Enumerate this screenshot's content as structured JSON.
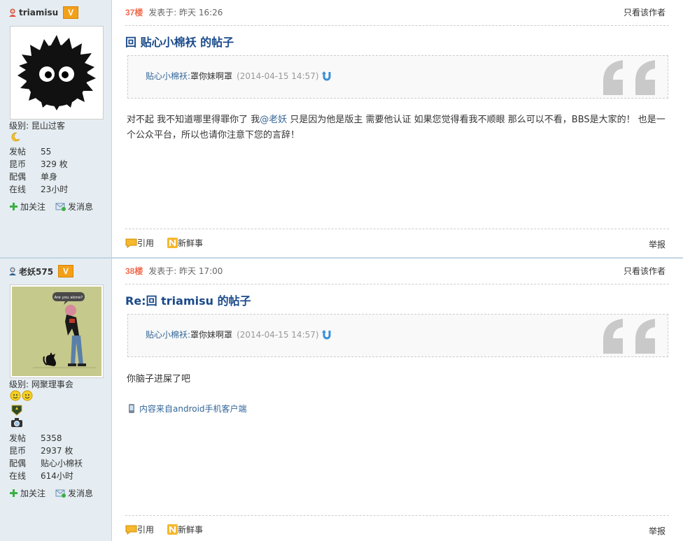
{
  "posts": [
    {
      "user": {
        "name": "triamisu",
        "badge": "V",
        "level_label": "级别:",
        "level": "昆山过客",
        "stats": [
          {
            "k": "发帖",
            "v": "55"
          },
          {
            "k": "昆币",
            "v": "329 枚"
          },
          {
            "k": "配偶",
            "v": "单身"
          },
          {
            "k": "在线",
            "v": "23小时"
          }
        ],
        "follow": "加关注",
        "message": "发消息"
      },
      "floor": "37楼",
      "posted": "发表于: 昨天 16:26",
      "only_author": "只看该作者",
      "title": "回 贴心小棉袄 的帖子",
      "quote": {
        "author": "贴心小棉袄:",
        "text": "罩你妹啊罩",
        "date": "(2014-04-15 14:57)"
      },
      "body_1": "对不起  我不知道哪里得罪你了  我",
      "mention": "@老妖",
      "body_2": "  只是因为他是版主  需要他认证   如果您觉得看我不顺眼  那么可以不看，BBS是大家的！  也是一个公众平台，所以也请你注意下您的言辞！",
      "actions": {
        "quote": "引用",
        "fresh": "新鲜事",
        "report": "举报"
      }
    },
    {
      "user": {
        "name": "老妖575",
        "badge": "V",
        "level_label": "级别:",
        "level": "网聚理事会",
        "stats": [
          {
            "k": "发帖",
            "v": "5358"
          },
          {
            "k": "昆币",
            "v": "2937 枚"
          },
          {
            "k": "配偶",
            "v": "贴心小棉袄"
          },
          {
            "k": "在线",
            "v": "614小时"
          }
        ],
        "follow": "加关注",
        "message": "发消息",
        "avatar_bubble": "Are you alone?"
      },
      "floor": "38楼",
      "posted": "发表于: 昨天 17:00",
      "only_author": "只看该作者",
      "title": "Re:回 triamisu 的帖子",
      "quote": {
        "author": "贴心小棉袄:",
        "text": "罩你妹啊罩",
        "date": "(2014-04-15 14:57)"
      },
      "body": "你脑子进屎了吧",
      "source": "内容来自android手机客户端",
      "actions": {
        "quote": "引用",
        "fresh": "新鲜事",
        "report": "举报"
      }
    }
  ],
  "colors": {
    "floor": "#f26c4f",
    "title": "#1a4a8a",
    "link": "#336699",
    "sidebar": "#e5edf2",
    "badge": "#f3a019"
  }
}
